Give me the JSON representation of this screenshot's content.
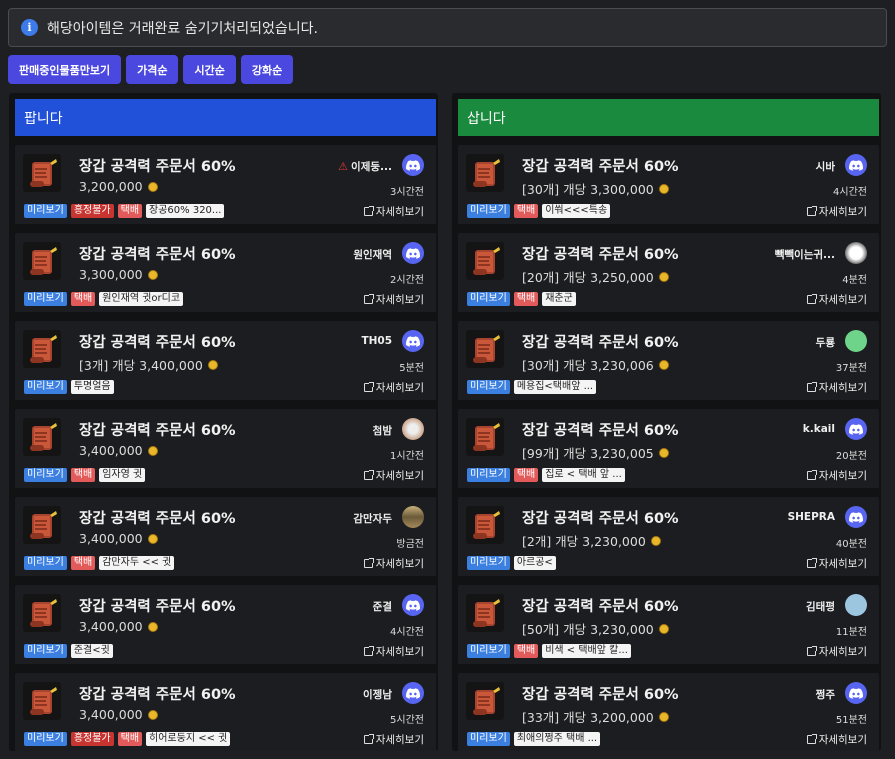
{
  "notice": "해당아이템은 거래완료 숨기기처리되었습니다.",
  "buttons": [
    "판매중인물품만보기",
    "가격순",
    "시간순",
    "강화순"
  ],
  "sell": {
    "header": "팝니다",
    "cards": [
      {
        "title": "장갑 공격력 주문서 60%",
        "price": "3,200,000",
        "user": "이제둥...",
        "warn": true,
        "avatar": "discord",
        "time": "3시간전",
        "tags": [
          [
            "미리보기",
            "blue"
          ],
          [
            "흥정불가",
            "red"
          ],
          [
            "택배",
            "pink"
          ]
        ],
        "note": "장공60% 320...",
        "detail": "자세히보기"
      },
      {
        "title": "장갑 공격력 주문서 60%",
        "price": "3,300,000",
        "user": "원인재역",
        "avatar": "discord",
        "time": "2시간전",
        "tags": [
          [
            "미리보기",
            "blue"
          ],
          [
            "택배",
            "pink"
          ]
        ],
        "note": "원인재역 귓or디코",
        "detail": "자세히보기"
      },
      {
        "title": "장갑 공격력 주문서 60%",
        "price": "[3개] 개당 3,400,000",
        "user": "TH05",
        "avatar": "discord",
        "time": "5분전",
        "tags": [
          [
            "미리보기",
            "blue"
          ]
        ],
        "note": "투명얼음",
        "detail": "자세히보기"
      },
      {
        "title": "장갑 공격력 주문서 60%",
        "price": "3,400,000",
        "user": "첨밤",
        "avatar": "photo1",
        "time": "1시간전",
        "tags": [
          [
            "미리보기",
            "blue"
          ],
          [
            "택배",
            "pink"
          ]
        ],
        "note": "임자영 귓",
        "detail": "자세히보기"
      },
      {
        "title": "장갑 공격력 주문서 60%",
        "price": "3,400,000",
        "user": "감만자두",
        "avatar": "photo2",
        "time": "방금전",
        "tags": [
          [
            "미리보기",
            "blue"
          ],
          [
            "택배",
            "pink"
          ]
        ],
        "note": "감만자두 << 귓",
        "detail": "자세히보기"
      },
      {
        "title": "장갑 공격력 주문서 60%",
        "price": "3,400,000",
        "user": "준결",
        "avatar": "discord",
        "time": "4시간전",
        "tags": [
          [
            "미리보기",
            "blue"
          ]
        ],
        "note": "준결<귓",
        "detail": "자세히보기"
      },
      {
        "title": "장갑 공격력 주문서 60%",
        "price": "3,400,000",
        "user": "이젱남",
        "avatar": "discord",
        "time": "5시간전",
        "tags": [
          [
            "미리보기",
            "blue"
          ],
          [
            "흥정불가",
            "red"
          ],
          [
            "택배",
            "pink"
          ]
        ],
        "note": "히어로둥지 << 귓",
        "detail": "자세히보기"
      }
    ]
  },
  "buy": {
    "header": "삽니다",
    "cards": [
      {
        "title": "장갑 공격력 주문서 60%",
        "price": "[30개] 개당 3,300,000",
        "user": "시바",
        "avatar": "discord",
        "time": "4시간전",
        "tags": [
          [
            "미리보기",
            "blue"
          ],
          [
            "택배",
            "pink"
          ]
        ],
        "note": "이쒀<<<특송",
        "detail": "자세히보기"
      },
      {
        "title": "장갑 공격력 주문서 60%",
        "price": "[20개] 개당 3,250,000",
        "user": "빽빽이는귀...",
        "avatar": "photo3",
        "time": "4분전",
        "tags": [
          [
            "미리보기",
            "blue"
          ],
          [
            "택배",
            "pink"
          ]
        ],
        "note": "재춘군",
        "detail": "자세히보기"
      },
      {
        "title": "장갑 공격력 주문서 60%",
        "price": "[30개] 개당 3,230,006",
        "user": "두룡",
        "avatar": "green",
        "time": "37분전",
        "tags": [
          [
            "미리보기",
            "blue"
          ]
        ],
        "note": "메용집<택배앞 ...",
        "detail": "자세히보기"
      },
      {
        "title": "장갑 공격력 주문서 60%",
        "price": "[99개] 개당 3,230,005",
        "user": "k.kail",
        "avatar": "discord",
        "time": "20분전",
        "tags": [
          [
            "미리보기",
            "blue"
          ],
          [
            "택배",
            "pink"
          ]
        ],
        "note": "집로 < 택배 앞 ...",
        "detail": "자세히보기"
      },
      {
        "title": "장갑 공격력 주문서 60%",
        "price": "[2개] 개당 3,230,000",
        "user": "SHEPRA",
        "avatar": "discord",
        "time": "40분전",
        "tags": [
          [
            "미리보기",
            "blue"
          ]
        ],
        "note": "아르공<",
        "detail": "자세히보기"
      },
      {
        "title": "장갑 공격력 주문서 60%",
        "price": "[50개] 개당 3,230,000",
        "user": "김태평",
        "avatar": "lightblue",
        "time": "11분전",
        "tags": [
          [
            "미리보기",
            "blue"
          ],
          [
            "택배",
            "pink"
          ]
        ],
        "note": "비색 < 택배앞 칼...",
        "detail": "자세히보기"
      },
      {
        "title": "장갑 공격력 주문서 60%",
        "price": "[33개] 개당 3,200,000",
        "user": "쩡주",
        "avatar": "discord",
        "time": "51분전",
        "tags": [
          [
            "미리보기",
            "blue"
          ]
        ],
        "note": "최애의쩡주 택배 ...",
        "detail": "자세히보기"
      }
    ]
  }
}
